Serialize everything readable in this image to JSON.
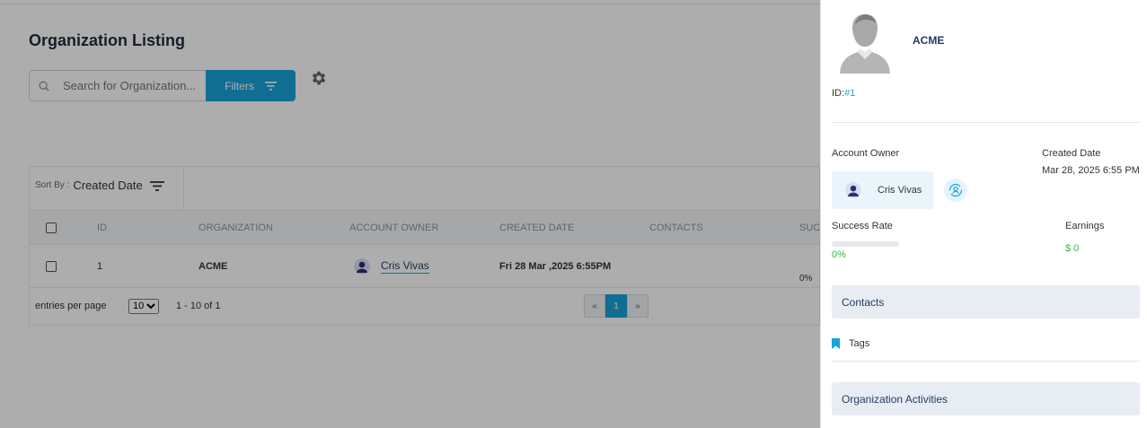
{
  "page": {
    "title": "Organization Listing",
    "search_placeholder": "Search for Organization...",
    "filters_label": "Filters"
  },
  "sortbar": {
    "prefix": "Sort By :",
    "value": "Created Date"
  },
  "table": {
    "columns": [
      "ID",
      "ORGANIZATION",
      "ACCOUNT OWNER",
      "CREATED DATE",
      "CONTACTS",
      "SUC"
    ],
    "rows": [
      {
        "id": "1",
        "organization": "ACME",
        "owner": "Cris Vivas",
        "created": "Fri 28 Mar ,2025 6:55PM",
        "contacts": "",
        "success": "0%"
      }
    ]
  },
  "footer": {
    "entries_label": "entries per page",
    "per_page": "10",
    "range": "1 - 10 of 1",
    "prev": "«",
    "current_page": "1",
    "next": "»"
  },
  "panel": {
    "org_name": "ACME",
    "id_label": "ID:",
    "id_value": "#1",
    "account_owner_label": "Account Owner",
    "account_owner": "Cris Vivas",
    "created_date_label": "Created Date",
    "created_date": "Mar 28, 2025 6:55 PM",
    "success_rate_label": "Success Rate",
    "success_rate": "0%",
    "success_rate_fraction": 0,
    "earnings_label": "Earnings",
    "earnings": "$ 0",
    "contacts_label": "Contacts",
    "tags_label": "Tags",
    "activities_label": "Organization Activities"
  },
  "colors": {
    "accent": "#1aa3d9",
    "title": "#1f3a5f",
    "success": "#3ab54a"
  }
}
